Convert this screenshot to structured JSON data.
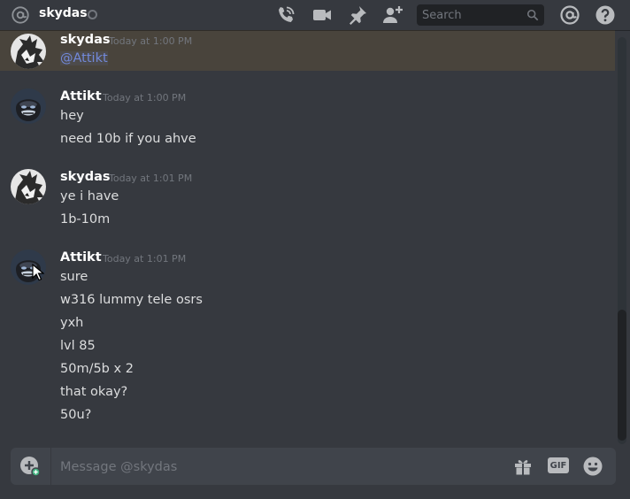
{
  "header": {
    "channel_name": "skydas",
    "search_placeholder": "Search"
  },
  "messages": [
    {
      "username": "skydas",
      "timestamp": "Today at 1:00 PM",
      "lines": [
        "@Attikt"
      ],
      "highlighted": true,
      "avatar": "skydas-avatar"
    },
    {
      "username": "Attikt",
      "timestamp": "Today at 1:00 PM",
      "lines": [
        "hey",
        "need 10b if you ahve"
      ],
      "avatar": "gorilla-avatar"
    },
    {
      "username": "skydas",
      "timestamp": "Today at 1:01 PM",
      "lines": [
        "ye i have",
        "1b-10m"
      ],
      "avatar": "skydas-avatar"
    },
    {
      "username": "Attikt",
      "timestamp": "Today at 1:01 PM",
      "lines": [
        "sure",
        "w316 lummy tele osrs",
        "yxh",
        "lvl 85",
        "50m/5b x 2",
        "that okay?",
        "50u?"
      ],
      "avatar": "gorilla-avatar"
    }
  ],
  "composer": {
    "placeholder": "Message @skydas",
    "gif_label": "GIF"
  },
  "colors": {
    "background": "#36393f",
    "mention": "#7289da",
    "highlight": "#49443c",
    "input_bg": "#40444b",
    "online_green": "#43b581"
  }
}
